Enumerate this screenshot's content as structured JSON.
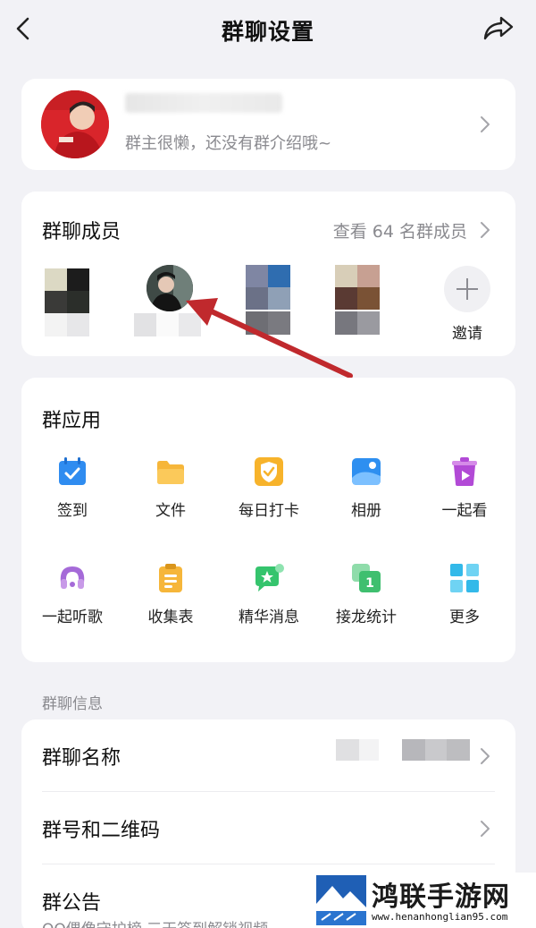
{
  "navbar": {
    "title": "群聊设置",
    "back_icon": "chevron-left-icon",
    "share_icon": "share-forward-icon"
  },
  "group_profile": {
    "intro": "群主很懒，还没有群介绍哦~"
  },
  "members": {
    "title": "群聊成员",
    "view_all": "查看 64 名群成员",
    "invite_label": "邀请"
  },
  "apps": {
    "title": "群应用",
    "items": [
      {
        "label": "签到",
        "icon": "calendar-check-icon",
        "color": "#2f8cf0"
      },
      {
        "label": "文件",
        "icon": "folder-icon",
        "color": "#f6b63a"
      },
      {
        "label": "每日打卡",
        "icon": "shield-check-icon",
        "color": "#f7b32b"
      },
      {
        "label": "相册",
        "icon": "photo-album-icon",
        "color": "#2e8ff0"
      },
      {
        "label": "一起看",
        "icon": "watch-together-icon",
        "color": "#b24ad6"
      },
      {
        "label": "一起听歌",
        "icon": "music-listen-icon",
        "color": "#a56ad8"
      },
      {
        "label": "收集表",
        "icon": "clipboard-form-icon",
        "color": "#f6b63a"
      },
      {
        "label": "精华消息",
        "icon": "chat-highlight-icon",
        "color": "#35c46d"
      },
      {
        "label": "接龙统计",
        "icon": "relay-stats-icon",
        "color": "#3fbf6f"
      },
      {
        "label": "更多",
        "icon": "grid-more-icon",
        "color": "#33b9e9"
      }
    ]
  },
  "info": {
    "section_label": "群聊信息",
    "name_label": "群聊名称",
    "qr_label": "群号和二维码",
    "notice_label": "群公告",
    "notice_preview": "QQ偶像守护榜 三天签到解锁视频"
  },
  "watermark": {
    "name": "鸿联手游网",
    "url": "www.henanhonglian95.com"
  }
}
